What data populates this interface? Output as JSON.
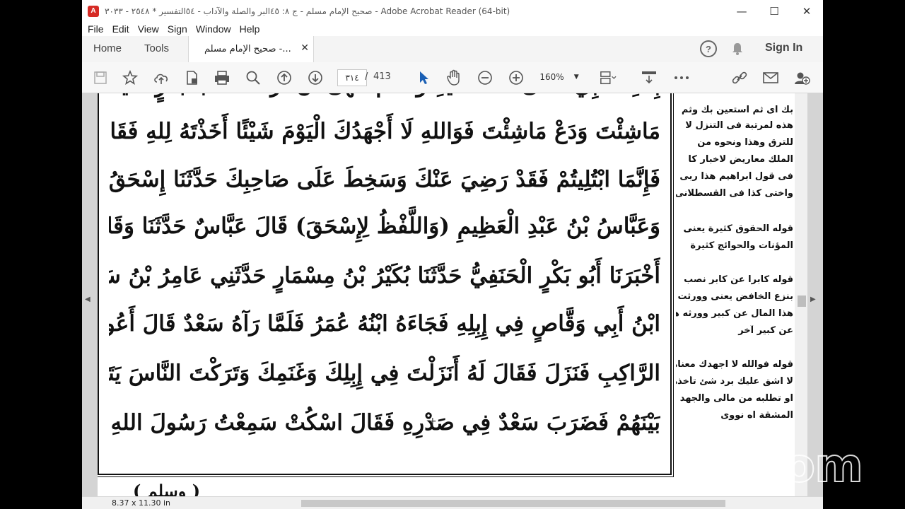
{
  "window": {
    "title": "صحيح الإمام مسلم - ج ٨: ٤٥البر والصلة والآداب - ٥٤التفسير * ٢٥٤٨ - ٣٠٣٣ - Adobe Acrobat Reader (64-bit)"
  },
  "menu": [
    "File",
    "Edit",
    "View",
    "Sign",
    "Window",
    "Help"
  ],
  "tabs": {
    "home": "Home",
    "tools": "Tools",
    "doc": "صحيح الإمام مسلم -..."
  },
  "header": {
    "signin": "Sign In"
  },
  "toolbar": {
    "page_current": "٣١٤",
    "page_sep": "/",
    "page_total": "413",
    "zoom": "160%"
  },
  "document": {
    "main_lines": [
      "بِنْتِ النَّبِيِّ صَلَّى اللهُ عَلَيْهِ وَسَلَّمَ تَنْهَى أَنْ تَرُدَّ اللهُ أَبَا بَكْرٍ شَيْئًا",
      "مَاشِئْتَ وَدَعْ مَاشِئْتَ فَوَاللهِ لَا أَجْهَدُكَ الْيَوْمَ شَيْئًا أَخَذْتَهُ لِلهِ فَقَالَ أَمْسِكْ مَالَكَ",
      "فَإِنَّمَا ابْتُلِيتُمْ فَقَدْ رَضِيَ عَنْكَ وَسَخِطَ عَلَى صَاحِبِكَ حَدَّثَنَا إِسْحَقُ بْنُ إِبْرَاهِيمَ",
      "وَعَبَّاسُ بْنُ عَبْدِ الْعَظِيمِ (وَاللَّفْظُ لِإِسْحَقَ) قَالَ عَبَّاسٌ حَدَّثَنَا وَقَالَ إِسْحَقُ",
      "أَخْبَرَنَا أَبُو بَكْرٍ الْحَنَفِيُّ حَدَّثَنَا بُكَيْرُ بْنُ مِسْمَارٍ حَدَّثَنِي عَامِرُ بْنُ سَعْدٍ قَالَ كَانَ سَعْدُ",
      "ابْنُ أَبِي وَقَّاصٍ فِي إِبِلِهِ فَجَاءَهُ ابْنُهُ عُمَرُ فَلَمَّا رَآهُ سَعْدٌ قَالَ أَعُوذُ بِاللهِ مِنْ شَرِّ هَذَا",
      "الرَّاكِبِ فَنَزَلَ فَقَالَ لَهُ أَنَزَلْتَ فِي إِبِلِكَ وَغَنَمِكَ وَتَرَكْتَ النَّاسَ يَتَنَازَعُونَ الْمُلْكَ",
      "بَيْنَهُمْ فَضَرَبَ سَعْدٌ فِي صَدْرِهِ فَقَالَ اسْكُتْ سَمِعْتُ رَسُولَ اللهِ صَلَّى اللهُ عَلَيْهِ"
    ],
    "footer_partial": "( وسلم )",
    "side_lines": [
      "بك اى ثم استعين بك وثم",
      "هذه لمرتبة فى التنزل لا",
      "للترق وهذا ونحوه من",
      "الملك معاريض لاخبار كا",
      "فى قول ابراهيم هذا ربى",
      "واختى كذا فى القسطلانى",
      "قوله الحقوق كثيرة يعنى",
      "المؤنات والحوائج كثيرة",
      "قوله كابرا عن كابر نصب",
      "بنزع الخافض يعنى وورثت",
      "هذا المال عن كبير وورثه هو",
      "عن كبير آخر",
      "قوله فوالله لا اجهدك معناه",
      "لا اشق عليك برد شئ تأخذه",
      "او تطلبه من مالى والجهد",
      "المشقة اه نووى"
    ]
  },
  "status": {
    "dimensions": "8.37 x 11.30 in"
  },
  "overlay": {
    "logo": "zoom"
  },
  "colors": {
    "acrobat_red": "#d62b25",
    "toolbar_bg": "#f7f7f7",
    "cursor_blue": "#1a5fb4"
  }
}
